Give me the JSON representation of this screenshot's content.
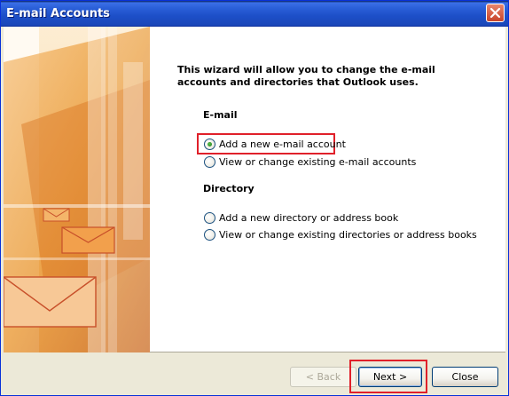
{
  "window": {
    "title": "E-mail Accounts"
  },
  "intro": {
    "line1": "This wizard will allow you to change the e-mail",
    "line2": "accounts and directories that Outlook uses."
  },
  "email_section": {
    "heading": "E-mail",
    "options": [
      {
        "label": "Add a new e-mail account",
        "checked": true
      },
      {
        "label": "View or change existing e-mail accounts",
        "checked": false
      }
    ]
  },
  "directory_section": {
    "heading": "Directory",
    "options": [
      {
        "label": "Add a new directory or address book",
        "checked": false
      },
      {
        "label": "View or change existing directories or address books",
        "checked": false
      }
    ]
  },
  "buttons": {
    "back": "< Back",
    "next": "Next >",
    "close": "Close"
  },
  "colors": {
    "titlebar": "#2a5fd8",
    "highlight": "#e0202a",
    "art_orange": "#e8942c"
  },
  "icons": {
    "close": "close-icon",
    "envelope": "envelope-icon"
  }
}
